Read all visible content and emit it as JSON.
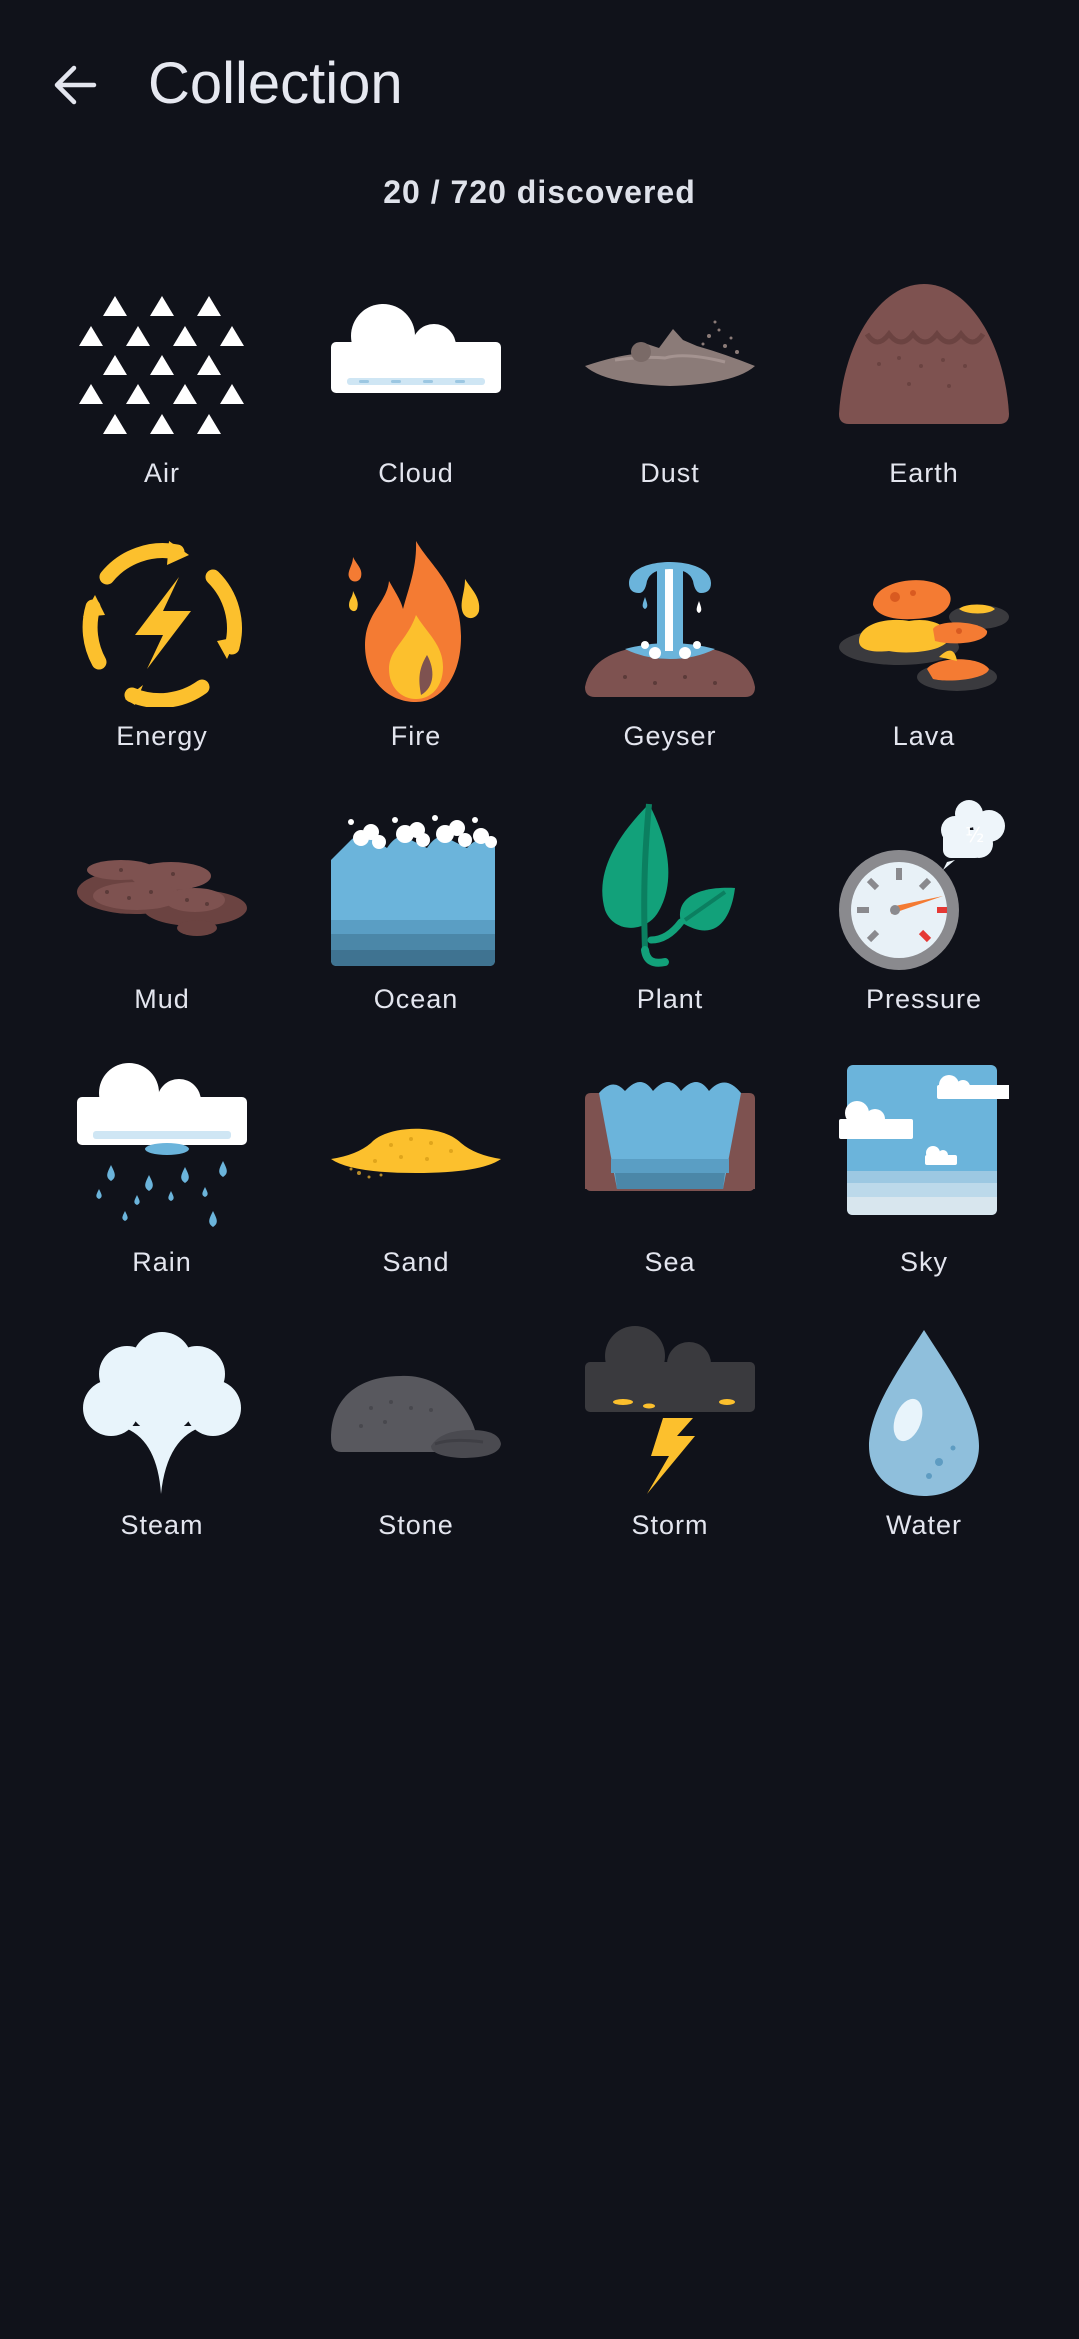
{
  "header": {
    "title": "Collection",
    "back_icon": "arrow-left-icon"
  },
  "progress": {
    "text": "20 / 720 discovered",
    "discovered": 20,
    "total": 720
  },
  "elements": [
    {
      "name": "Air",
      "icon": "air-icon"
    },
    {
      "name": "Cloud",
      "icon": "cloud-icon"
    },
    {
      "name": "Dust",
      "icon": "dust-icon"
    },
    {
      "name": "Earth",
      "icon": "earth-icon"
    },
    {
      "name": "Energy",
      "icon": "energy-icon"
    },
    {
      "name": "Fire",
      "icon": "fire-icon"
    },
    {
      "name": "Geyser",
      "icon": "geyser-icon"
    },
    {
      "name": "Lava",
      "icon": "lava-icon"
    },
    {
      "name": "Mud",
      "icon": "mud-icon"
    },
    {
      "name": "Ocean",
      "icon": "ocean-icon"
    },
    {
      "name": "Plant",
      "icon": "plant-icon"
    },
    {
      "name": "Pressure",
      "icon": "pressure-icon"
    },
    {
      "name": "Rain",
      "icon": "rain-icon"
    },
    {
      "name": "Sand",
      "icon": "sand-icon"
    },
    {
      "name": "Sea",
      "icon": "sea-icon"
    },
    {
      "name": "Sky",
      "icon": "sky-icon"
    },
    {
      "name": "Steam",
      "icon": "steam-icon"
    },
    {
      "name": "Stone",
      "icon": "stone-icon"
    },
    {
      "name": "Storm",
      "icon": "storm-icon"
    },
    {
      "name": "Water",
      "icon": "water-icon"
    }
  ],
  "colors": {
    "background": "#10121a",
    "text": "#e3e5ee",
    "yellow": "#fcc02d",
    "orange": "#f47b33",
    "brown": "#7e5250",
    "blue": "#6bb4db",
    "green": "#12a17a"
  }
}
